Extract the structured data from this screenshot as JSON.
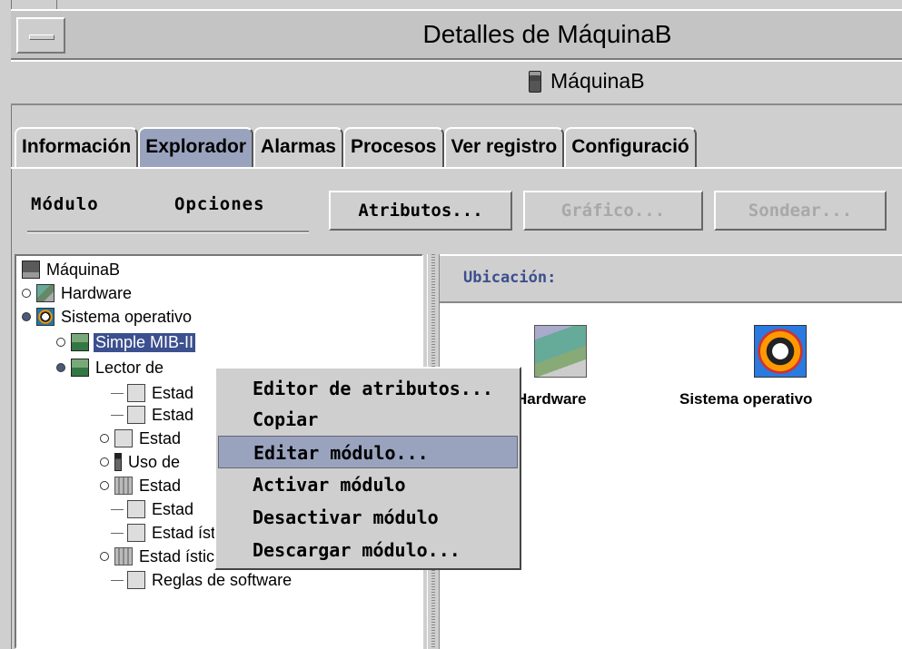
{
  "window": {
    "title": "Detalles de MáquinaB",
    "host_label": "MáquinaB"
  },
  "tabs": [
    {
      "label": "Información",
      "active": false
    },
    {
      "label": "Explorador",
      "active": true
    },
    {
      "label": "Alarmas",
      "active": false
    },
    {
      "label": "Procesos",
      "active": false
    },
    {
      "label": "Ver registro",
      "active": false
    },
    {
      "label": "Configuració",
      "active": false
    }
  ],
  "toolbar": {
    "menu_modulo": "Módulo",
    "menu_opciones": "Opciones",
    "btn_atributos": "Atributos...",
    "btn_grafico": "Gráfico...",
    "btn_sondear": "Sondear..."
  },
  "tree": [
    {
      "label": "MáquinaB",
      "icon": "host-icon"
    },
    {
      "label": "Hardware",
      "icon": "hardware-icon"
    },
    {
      "label": "Sistema operativo",
      "icon": "os-icon"
    },
    {
      "label": "Simple MIB-II",
      "icon": "module-icon",
      "selected": true
    },
    {
      "label": "Lector de",
      "icon": "module-icon"
    },
    {
      "label": "Estad",
      "icon": "stats-icon"
    },
    {
      "label": "Estad",
      "icon": "stats-icon"
    },
    {
      "label": "Estad",
      "icon": "disk-icon"
    },
    {
      "label": "Uso de",
      "icon": "bar-icon"
    },
    {
      "label": "Estad",
      "icon": "chip-icon"
    },
    {
      "label": "Estad",
      "icon": "stats-icon"
    },
    {
      "label": "Estad ísticas de intercambio",
      "icon": "disk-icon"
    },
    {
      "label": "Estad ísticas de flujos",
      "icon": "chip-icon"
    },
    {
      "label": "Reglas de software",
      "icon": "stats-icon"
    }
  ],
  "location": {
    "label": "Ubicación:"
  },
  "content_items": [
    {
      "label": "Hardware",
      "icon": "hardware-icon"
    },
    {
      "label": "Sistema operativo",
      "icon": "os-icon"
    }
  ],
  "context_menu": [
    {
      "label": "Editor de atributos...",
      "highlighted": false
    },
    {
      "label": "Copiar",
      "highlighted": false
    },
    {
      "label": "Editar módulo...",
      "highlighted": true
    },
    {
      "label": "Activar módulo",
      "highlighted": false
    },
    {
      "label": "Desactivar módulo",
      "highlighted": false
    },
    {
      "label": "Descargar módulo...",
      "highlighted": false
    }
  ],
  "colors": {
    "background": "#cfcfcf",
    "selection": "#3c4f8e",
    "active_tab": "#9aa3be",
    "location_label": "#3c4f8e"
  }
}
